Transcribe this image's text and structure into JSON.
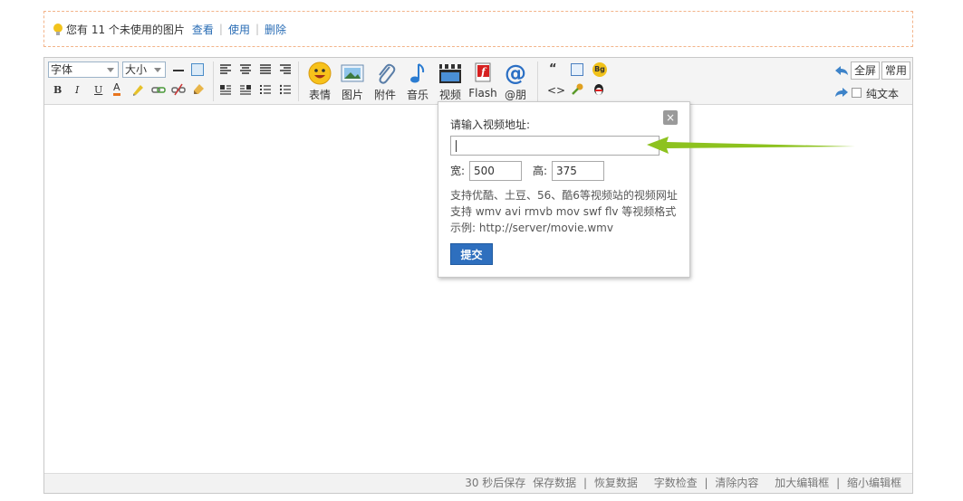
{
  "notice": {
    "text": "您有 11 个未使用的图片",
    "links": [
      "查看",
      "使用",
      "删除"
    ]
  },
  "toolbar": {
    "font_select": "字体",
    "size_select": "大小",
    "big_buttons": [
      {
        "label": "表情",
        "icon": "smiley-icon"
      },
      {
        "label": "图片",
        "icon": "image-icon"
      },
      {
        "label": "附件",
        "icon": "paperclip-icon"
      },
      {
        "label": "音乐",
        "icon": "music-note-icon"
      },
      {
        "label": "视频",
        "icon": "film-clapper-icon"
      },
      {
        "label": "Flash",
        "icon": "flash-icon"
      },
      {
        "label": "@朋",
        "icon": "at-sign-icon"
      }
    ],
    "fullscreen_label": "全屏",
    "common_label": "常用",
    "plaintext_label": "纯文本"
  },
  "popup": {
    "title": "请输入视频地址:",
    "close_glyph": "×",
    "url_value": "",
    "width_label": "宽:",
    "width_value": "500",
    "height_label": "高:",
    "height_value": "375",
    "help_lines": [
      "支持优酷、土豆、56、酷6等视频站的视频网址",
      "支持 wmv avi rmvb mov swf flv 等视频格式",
      "示例: http://server/movie.wmv"
    ],
    "submit_label": "提交"
  },
  "status": {
    "autosave": "30 秒后保存",
    "items": [
      "保存数据",
      "恢复数据",
      "字数检查",
      "清除内容",
      "加大编辑框",
      "缩小编辑框"
    ]
  },
  "colors": {
    "link": "#2a6db5",
    "submit_bg": "#2e6fbe",
    "arrow": "#8dc21f",
    "notice_border": "#f3b48a"
  }
}
